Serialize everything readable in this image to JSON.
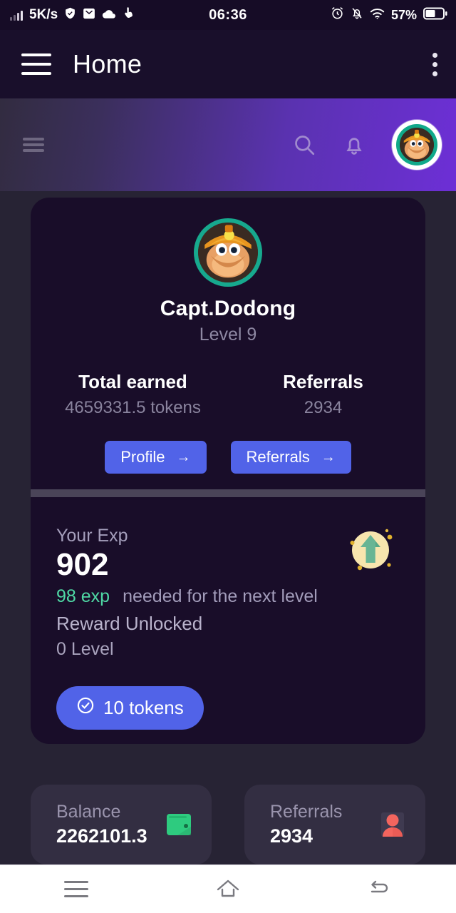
{
  "status_bar": {
    "network_speed": "5K/s",
    "time": "06:36",
    "battery_percent": "57%",
    "icons_left": [
      "signal-bars-icon",
      "shield-check-icon",
      "mail-icon",
      "cloud-icon",
      "touch-icon"
    ],
    "icons_right": [
      "alarm-clock-icon",
      "bell-muted-icon",
      "wifi-icon",
      "battery-icon"
    ]
  },
  "app_bar": {
    "title": "Home",
    "menu_icon": "hamburger-menu-icon",
    "overflow_icon": "kebab-menu-icon"
  },
  "web_header": {
    "menu_icon": "hamburger-menu-icon",
    "search_icon": "search-icon",
    "notification_icon": "bell-icon",
    "avatar_icon": "user-avatar-monkey-icon",
    "gradient_from": "#322c40",
    "gradient_to": "#6d2fd6"
  },
  "profile": {
    "avatar_icon": "monkey-miner-avatar",
    "username": "Capt.Dodong",
    "level": "Level 9",
    "stats": [
      {
        "label": "Total earned",
        "value": "4659331.5 tokens"
      },
      {
        "label": "Referrals",
        "value": "2934"
      }
    ],
    "buttons": [
      {
        "label": "Profile",
        "arrow": "→"
      },
      {
        "label": "Referrals",
        "arrow": "→"
      }
    ]
  },
  "exp": {
    "label": "Your Exp",
    "value": "902",
    "needed_amount": "98 exp",
    "needed_text": "needed for the next level",
    "reward_unlocked_label": "Reward Unlocked",
    "reward_level": "0 Level",
    "reward_button": "10 tokens",
    "reward_button_icon": "check-circle-icon",
    "levelup_icon": "level-up-arrow-icon",
    "accent_green": "#4fd9a5",
    "accent_blue": "#5163e8"
  },
  "bottom_cards": [
    {
      "label": "Balance",
      "value": "2262101.3",
      "icon": "wallet-icon",
      "icon_color": "#2ecb7f"
    },
    {
      "label": "Referrals",
      "value": "2934",
      "icon": "person-icon",
      "icon_color": "#f4655e"
    }
  ],
  "nav_bar": {
    "recents_icon": "recent-apps-icon",
    "home_icon": "home-icon",
    "back_icon": "back-icon"
  }
}
